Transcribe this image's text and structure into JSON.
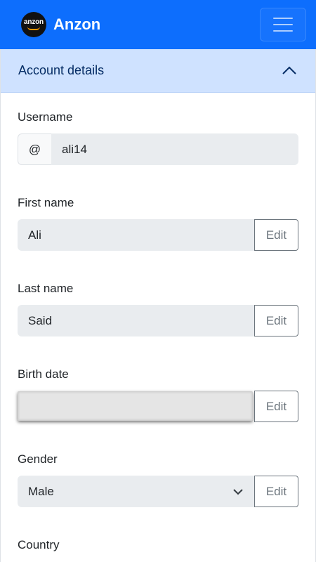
{
  "navbar": {
    "logo_text": "anzon",
    "brand": "Anzon"
  },
  "accordion": {
    "title": "Account details"
  },
  "fields": {
    "username": {
      "label": "Username",
      "prefix": "@",
      "value": "ali14"
    },
    "first_name": {
      "label": "First name",
      "value": "Ali",
      "button": "Edit"
    },
    "last_name": {
      "label": "Last name",
      "value": "Said",
      "button": "Edit"
    },
    "birth_date": {
      "label": "Birth date",
      "value": "",
      "button": "Edit"
    },
    "gender": {
      "label": "Gender",
      "value": "Male",
      "button": "Edit"
    },
    "country": {
      "label": "Country"
    }
  },
  "colors": {
    "navbar": "#0d6efd",
    "accordion_header": "#cfe2ff",
    "input_bg": "#e9ecef",
    "edit_border": "#6c757d"
  },
  "icons": {
    "menu": "hamburger-icon",
    "collapse": "chevron-up-icon",
    "select": "chevron-down-icon"
  }
}
